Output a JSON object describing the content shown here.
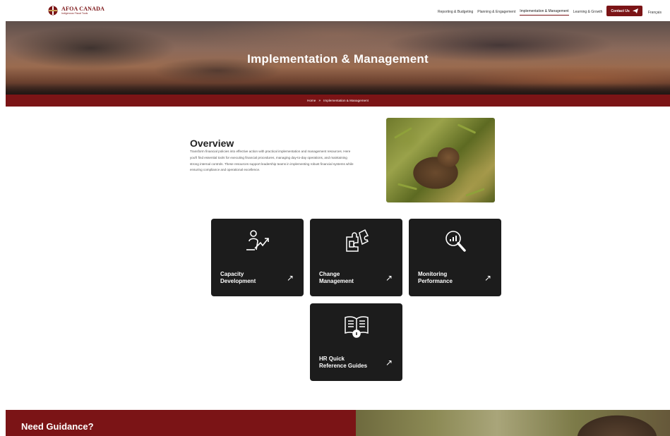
{
  "header": {
    "logo_title": "AFOA CANADA",
    "logo_subtitle": "Indigenous Fiscal Tools",
    "nav": [
      {
        "label": "Reporting & Budgeting"
      },
      {
        "label": "Planning & Engagement"
      },
      {
        "label": "Implementation & Management"
      },
      {
        "label": "Learning & Growth"
      }
    ],
    "contact_label": "Contact Us",
    "language": "Français"
  },
  "hero": {
    "title": "Implementation & Management"
  },
  "breadcrumb": {
    "home": "Home",
    "separator": "»",
    "current": "Implementation & Management"
  },
  "overview": {
    "title": "Overview",
    "text": "Transform financial policies into effective action with practical implementation and management resources. Here you'll find essential tools for executing financial procedures, managing day-to-day operations, and maintaining strong internal controls. These resources support leadership teams in implementing robust financial systems while ensuring compliance and operational excellence."
  },
  "cards": [
    {
      "label": "Capacity\nDevelopment",
      "icon": "growth-person-icon"
    },
    {
      "label": "Change\nManagement",
      "icon": "puzzle-icon"
    },
    {
      "label": "Monitoring\nPerformance",
      "icon": "magnifier-chart-icon"
    },
    {
      "label": "HR Quick\nReference Guides",
      "icon": "book-info-icon"
    }
  ],
  "card_arrow": "↗",
  "guidance": {
    "title": "Need Guidance?"
  },
  "colors": {
    "brand": "#7b1416",
    "card": "#1c1c1c"
  }
}
